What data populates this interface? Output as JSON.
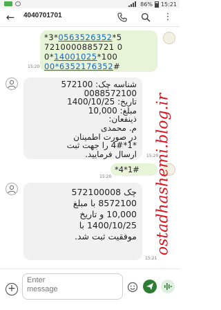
{
  "status_bar": {
    "battery": "86%",
    "time": "15:21"
  },
  "header": {
    "contact": "4040701701",
    "icons": [
      "back-arrow-icon",
      "phone-icon",
      "search-icon",
      "more-vert-icon"
    ]
  },
  "messages": [
    {
      "direction": "outgoing",
      "lines": [
        "*3*0563526352*5",
        "7210000885721 0",
        "0*14001025*100",
        "00*6352176352#"
      ],
      "time": "15:20"
    },
    {
      "direction": "incoming",
      "lines": [
        "شناسه چک: 572100",
        "0088572100",
        "تاریخ: 1400/10/25",
        "مبلغ: 10,000",
        "ذینفعان:",
        "م. محمدی",
        "در صورت اطمینان",
        "*1*4# را جهت ثبت",
        "ارسال فرمایید."
      ],
      "time": "15:20"
    },
    {
      "direction": "outgoing",
      "lines": [
        "*4*1#"
      ],
      "time": "15:20"
    },
    {
      "direction": "incoming",
      "lines": [
        "چک 572100008",
        "8572100 با مبلغ",
        "10,000 و تاریخ",
        "1400/10/25 با",
        "موفقیت ثبت شد."
      ],
      "time": "15:21"
    }
  ],
  "watermark": "ostadhashemi.blog.ir",
  "input": {
    "placeholder": "Enter\nmessage"
  },
  "colors": {
    "outgoing_bubble": "#e7f4d8",
    "incoming_bubble": "#f1f1f1",
    "link": "#1565c0",
    "watermark": "#e0141e"
  }
}
